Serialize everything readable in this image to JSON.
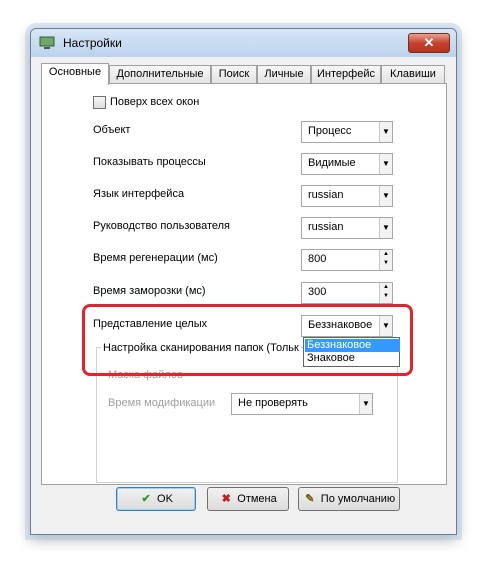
{
  "window": {
    "title": "Настройки"
  },
  "tabs": [
    "Основные",
    "Дополнительные",
    "Поиск",
    "Личные",
    "Интерфейс",
    "Клавиши"
  ],
  "options": {
    "always_on_top": {
      "label": "Поверх всех окон",
      "checked": false
    },
    "object": {
      "label": "Объект",
      "value": "Процесс"
    },
    "show_processes": {
      "label": "Показывать процессы",
      "value": "Видимые"
    },
    "interface_language": {
      "label": "Язык интерфейса",
      "value": "russian"
    },
    "user_guide": {
      "label": "Руководство пользователя",
      "value": "russian"
    },
    "refresh_time": {
      "label": "Время регенерации (мс)",
      "value": "800"
    },
    "freeze_time": {
      "label": "Время заморозки (мс)",
      "value": "300"
    },
    "integer_repr": {
      "label": "Представление целых",
      "value": "Беззнаковое"
    }
  },
  "dropdown": {
    "items": [
      "Беззнаковое",
      "Знаковое"
    ],
    "selected": "Беззнаковое"
  },
  "folder_scan": {
    "title": "Настройка сканирования папок (Тольк",
    "hidden_label": "Маска файлов",
    "mod_time_label": "Время модификации",
    "mod_time_value": "Не проверять"
  },
  "buttons": {
    "ok": "OK",
    "cancel": "Отмена",
    "default": "По умолчанию"
  },
  "colors": {
    "highlight": "#e2242e",
    "selection": "#3399ff"
  }
}
